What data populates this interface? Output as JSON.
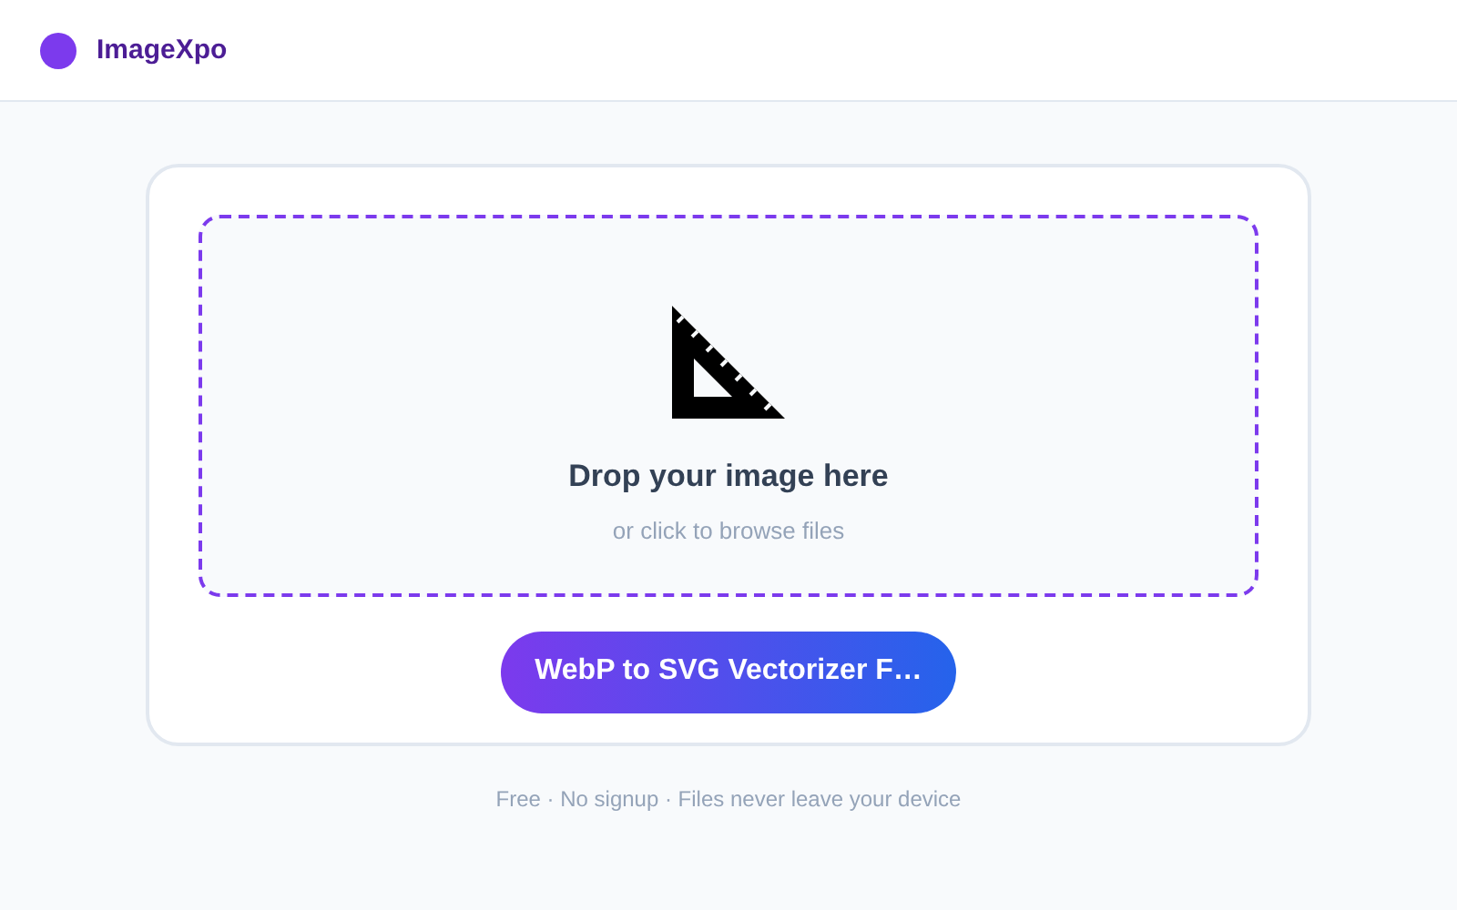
{
  "header": {
    "brand": "ImageXpo"
  },
  "dropzone": {
    "title": "Drop your image here",
    "hint": "or click to browse files"
  },
  "action_button": {
    "label": "WebP to SVG Vectorizer F…"
  },
  "footer_note": "Free · No signup · Files never leave your device"
}
